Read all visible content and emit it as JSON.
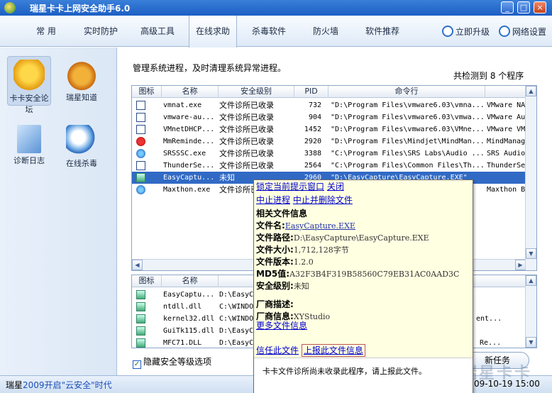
{
  "window": {
    "title": "瑞星卡卡上网安全助手6.0",
    "min": "_",
    "max": "□",
    "close": "×"
  },
  "nav": {
    "tabs": [
      "常 用",
      "实时防护",
      "高级工具",
      "在线求助",
      "杀毒软件",
      "防火墙",
      "软件推荐"
    ],
    "active": "在线求助",
    "upgrade": "立即升级",
    "settings": "网络设置"
  },
  "left": {
    "items": [
      {
        "label": "卡卡安全论坛",
        "icon": "forum-icon"
      },
      {
        "label": "瑞星知道",
        "icon": "knowledge-icon"
      },
      {
        "label": "诊断日志",
        "icon": "diagnostic-log-icon"
      },
      {
        "label": "在线杀毒",
        "icon": "online-scan-icon"
      }
    ]
  },
  "main": {
    "subtitle": "管理系统进程，及时清理系统异常进程。",
    "count": "共检测到 8 个程序",
    "columns": [
      "图标",
      "名称",
      "安全级别",
      "PID",
      "命令行",
      "描"
    ],
    "rows": [
      {
        "name": "vmnat.exe",
        "level": "文件诊所已收录",
        "pid": "732",
        "cmd": "\"D:\\Program Files\\vmware6.03\\vmna...",
        "desc": "VMware NAT S",
        "icon": "window-icon"
      },
      {
        "name": "vmware-au...",
        "level": "文件诊所已收录",
        "pid": "904",
        "cmd": "\"D:\\Program Files\\vmware6.03\\vmwa...",
        "desc": "VMware Authe",
        "icon": "window-icon"
      },
      {
        "name": "VMnetDHCP...",
        "level": "文件诊所已收录",
        "pid": "1452",
        "cmd": "\"D:\\Program Files\\vmware6.03\\VMne...",
        "desc": "VMware VMnet",
        "icon": "window-icon"
      },
      {
        "name": "MmReminde...",
        "level": "文件诊所已收录",
        "pid": "2920",
        "cmd": "\"D:\\Program Files\\Mindjet\\MindMan...",
        "desc": "MindManager",
        "icon": "mindmanager-icon"
      },
      {
        "name": "SRSSSC.exe",
        "level": "文件诊所已收录",
        "pid": "3388",
        "cmd": "\"C:\\Program Files\\SRS Labs\\Audio ...",
        "desc": "SRS Audio Sa",
        "icon": "srs-icon"
      },
      {
        "name": "ThunderSe...",
        "level": "文件诊所已收录",
        "pid": "2564",
        "cmd": "\"C:\\Program Files\\Common Files\\Th...",
        "desc": "ThunderServi",
        "icon": "window-icon"
      },
      {
        "name": "EasyCaptu...",
        "level": "未知",
        "pid": "2960",
        "cmd": "\"D:\\EasyCapture\\EasyCapture.EXE\"",
        "desc": "",
        "icon": "easycapture-icon"
      },
      {
        "name": "Maxthon.exe",
        "level": "文件诊所已收录",
        "pid": "",
        "cmd": "",
        "desc": "Maxthon Brow",
        "icon": "maxthon-icon"
      }
    ],
    "lower_columns": [
      "图标",
      "名称"
    ],
    "lower_rows": [
      {
        "name": "EasyCaptu...",
        "path": "D:\\EasyC",
        "extra": ""
      },
      {
        "name": "ntdll.dll",
        "path": "C:\\WINDO",
        "extra": ""
      },
      {
        "name": "kernel32.dll",
        "path": "C:\\WINDO",
        "extra": "ent..."
      },
      {
        "name": "GuiTk115.dll",
        "path": "D:\\EasyC",
        "extra": ""
      },
      {
        "name": "MFC71.DLL",
        "path": "D:\\EasyC",
        "extra": "Re..."
      }
    ],
    "checkbox": "隐藏安全等级选项",
    "new_task": "新任务"
  },
  "popup": {
    "lock": "锁定当前提示窗口",
    "close": "关闭",
    "stop": "中止进程",
    "stop_delete": "中止并删除文件",
    "section": "相关文件信息",
    "fname_label": "文件名:",
    "fname": "EasyCapture.EXE",
    "fpath_label": "文件路径:",
    "fpath": "D:\\EasyCapture\\EasyCapture.EXE",
    "fsize_label": "文件大小:",
    "fsize": "1,712,128字节",
    "fver_label": "文件版本:",
    "fver": "1.2.0",
    "md5_label": "MD5值:",
    "md5": "A32F3B4F319B58560C79EB31AC0AAD3C",
    "level_label": "安全级别:",
    "level": "未知",
    "vendor_desc_label": "厂商描述:",
    "vendor_info_label": "厂商信息:",
    "vendor_info": "XYStudio",
    "more": "更多文件信息",
    "trust": "信任此文件",
    "report": "上报此文件信息",
    "footer": "卡卡文件诊所尚未收录此程序，请上报此文件。"
  },
  "status": {
    "prefix": "瑞星",
    "link": "2009开启\"云安全\"时代",
    "datetime": "09-10-19 15:00",
    "watermark": "瑞星卡卡"
  }
}
